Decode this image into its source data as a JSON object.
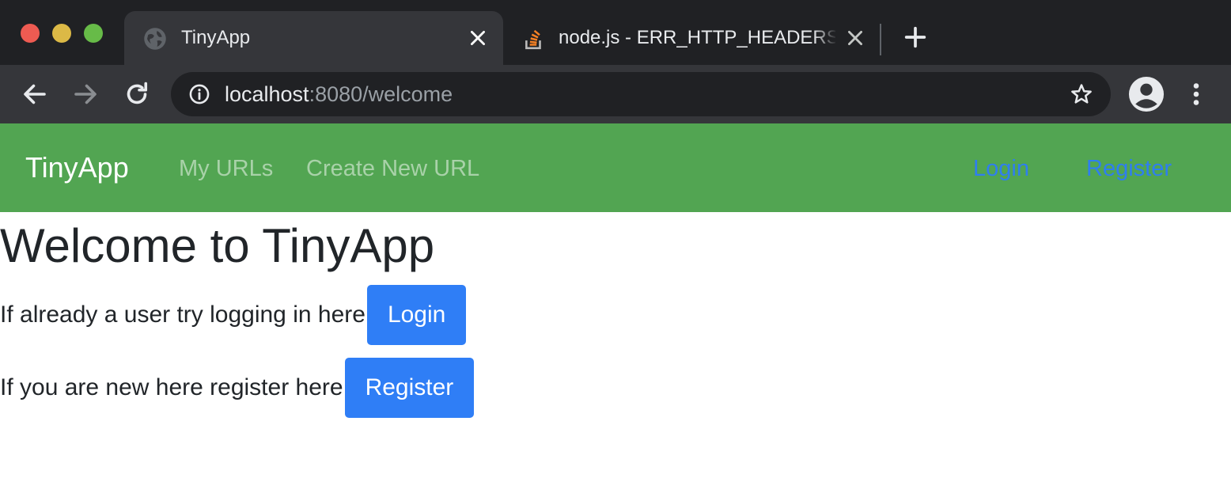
{
  "browser": {
    "tabs": [
      {
        "title": "TinyApp",
        "favicon": "globe-icon",
        "active": true
      },
      {
        "title": "node.js - ERR_HTTP_HEADERS_SENT",
        "favicon": "stackoverflow-icon",
        "active": false
      }
    ],
    "address": {
      "host": "localhost",
      "rest": ":8080/welcome"
    }
  },
  "navbar": {
    "brand": "TinyApp",
    "links": [
      "My URLs",
      "Create New URL"
    ],
    "login": "Login",
    "register": "Register",
    "colors": {
      "background": "#52a552",
      "auth_link": "#2f7ef0"
    }
  },
  "main": {
    "heading": "Welcome to TinyApp",
    "login_prompt": "If already a user try logging in here",
    "login_button": "Login",
    "register_prompt": "If you are new here register here",
    "register_button": "Register",
    "button_color": "#2f7ef6"
  }
}
